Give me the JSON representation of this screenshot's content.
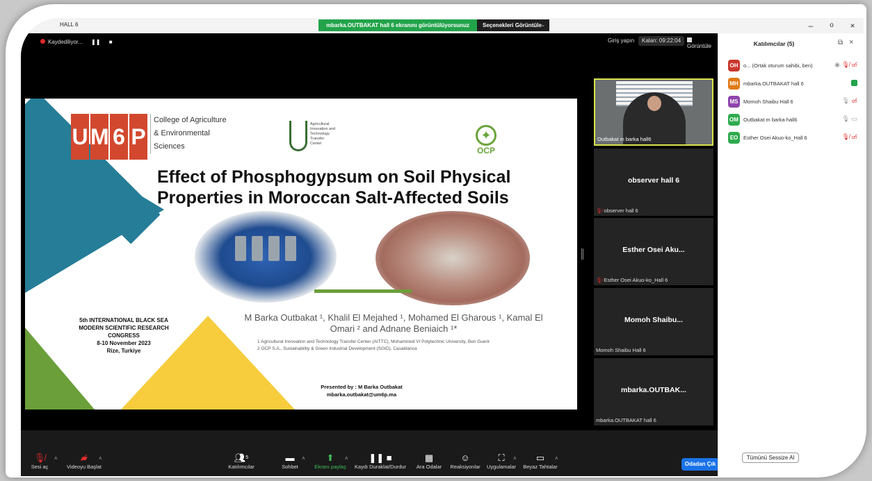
{
  "window": {
    "title": "HALL 6",
    "share_banner": "mbarka.OUTBAKAT hall 6 ekranını görüntülüyorsunuz",
    "view_options": "Seçenekleri Görüntüle",
    "minimize": "–",
    "maximize": "o",
    "close": "×"
  },
  "topbar": {
    "recording": "Kaydediliyor...",
    "signin": "Giriş yapın",
    "timer": "Kalan: 09:22:04",
    "view": "Görüntüle"
  },
  "slide": {
    "logo_letters": [
      "U",
      "M",
      "6",
      "P"
    ],
    "college": [
      "College of Agriculture",
      "& Environmental",
      "Sciences"
    ],
    "aitc": [
      "Agricultural",
      "Innovation and",
      "Technology",
      "Transfer",
      "Center"
    ],
    "ocp": "OCP",
    "title_line1": "Effect of Phosphogypsum on Soil Physical",
    "title_line2": "Properties in Moroccan Salt-Affected Soils",
    "authors": "M Barka Outbakat ¹, Khalil El Mejahed ¹, Mohamed El Gharous ¹, Kamal El Omari ² and Adnane Beniaich ¹*",
    "affil1": "1 Agricultural Innovation and Technology Transfer Center (AITTC), Mohammed VI Polytechnic University, Ben Guerir",
    "affil2": "2 OCP S.A., Sustainability & Green Industrial Development (SGID), Casablanca",
    "congress": [
      "5th INTERNATIONAL BLACK SEA",
      "MODERN SCIENTIFIC RESEARCH",
      "CONGRESS",
      "8-10 November 2023",
      "Rize, Turkiye"
    ],
    "presented": "Presented by : M Barka Outbakat",
    "email": "mbarka.outbakat@um6p.ma"
  },
  "tiles": [
    {
      "label": "Outbakat m barka hall6"
    },
    {
      "name": "observer hall 6",
      "label": "observer hall 6"
    },
    {
      "name": "Esther Osei Aku...",
      "label": "Esther Osei Akuo-ko_Hall 6"
    },
    {
      "name": "Momoh  Shaibu...",
      "label": "Momoh Shaibu Hall 6"
    },
    {
      "name": "mbarka.OUTBAK...",
      "label": "mbarka.OUTBAKAT hall 6"
    }
  ],
  "toolbar": {
    "audio": "Sesi aç",
    "video": "Videoyu Başlat",
    "participants": "Katılımcılar",
    "participants_count": "5",
    "chat": "Sohbet",
    "share": "Ekranı paylaş",
    "record": "Kaydı Duraklat/Durdur",
    "breakout": "Ara Odalar",
    "reactions": "Reaksiyonlar",
    "apps": "Uygulamalar",
    "whiteboard": "Beyaz Tahtalar",
    "leave": "Odadan Çık"
  },
  "panel": {
    "title": "Katılımcılar (5)",
    "participants": [
      {
        "initials": "OH",
        "color": "#c9372c",
        "name": "o... (Ortak oturum sahibi, ben)"
      },
      {
        "initials": "MH",
        "color": "#e07a16",
        "name": "mbarka.OUTBAKAT hall 6"
      },
      {
        "initials": "MS",
        "color": "#8e44ad",
        "name": "Momoh Shaibu Hall 6"
      },
      {
        "initials": "OM",
        "color": "#2eab4e",
        "name": "Outbakat m barka hall6"
      },
      {
        "initials": "EO",
        "color": "#2eab4e",
        "name": "Esther Osei Akuo-ko_Hall 6"
      }
    ],
    "mute_all": "Tümünü Sessize Al"
  },
  "colors": {
    "share_green": "#22a34a",
    "leave_blue": "#1a73e8",
    "slide_blue": "#267d97",
    "slide_yellow": "#f7cd3e",
    "slide_green": "#6b9f3a",
    "um6p_red": "#d2482e"
  }
}
